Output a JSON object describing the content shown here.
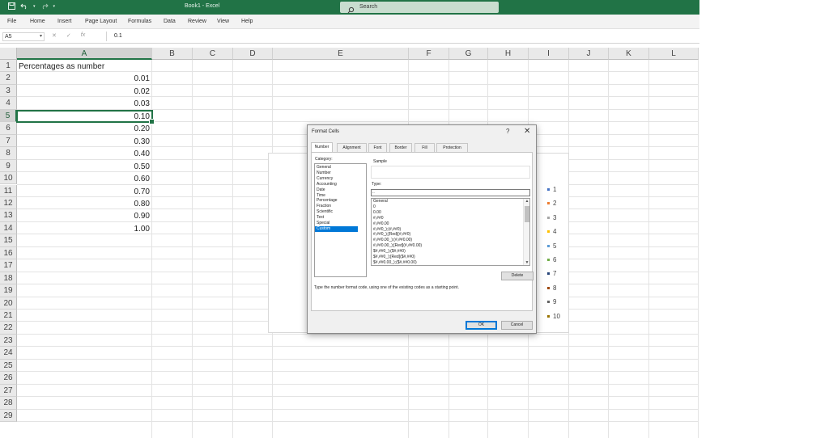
{
  "window": {
    "title": "Book1 - Excel",
    "search_placeholder": "Search"
  },
  "icons": {
    "save": "save-icon",
    "undo": "undo-icon",
    "redo": "redo-icon",
    "search": "search-icon"
  },
  "menu": [
    "File",
    "Home",
    "Insert",
    "Page Layout",
    "Formulas",
    "Data",
    "Review",
    "View",
    "Help"
  ],
  "formula_bar": {
    "name_box": "A5",
    "formula": "0.1",
    "fx": "fx",
    "cancel": "✕",
    "enter": "✓"
  },
  "sheet": {
    "columns": [
      "A",
      "B",
      "C",
      "D",
      "E",
      "F",
      "G",
      "H",
      "I",
      "J",
      "K",
      "L"
    ],
    "rows": [
      "1",
      "2",
      "3",
      "4",
      "5",
      "6",
      "7",
      "8",
      "9",
      "10",
      "11",
      "12",
      "13",
      "14",
      "15",
      "16",
      "17",
      "18",
      "19",
      "20",
      "21",
      "22",
      "23",
      "24",
      "25",
      "26",
      "27",
      "28",
      "29"
    ],
    "selected_column": "A",
    "selected_row": "5",
    "header_cell": "Percentages as number",
    "values": [
      "0.01",
      "0.02",
      "0.03",
      "0.10",
      "0.20",
      "0.30",
      "0.40",
      "0.50",
      "0.60",
      "0.70",
      "0.80",
      "0.90",
      "1.00"
    ]
  },
  "chart_legend": {
    "labels": [
      "1",
      "2",
      "3",
      "4",
      "5",
      "6",
      "7",
      "8",
      "9",
      "10"
    ],
    "colors": [
      "#4472c4",
      "#ed7d31",
      "#a5a5a5",
      "#ffc000",
      "#5b9bd5",
      "#70ad47",
      "#264478",
      "#9e480e",
      "#636363",
      "#997300"
    ]
  },
  "dialog": {
    "title": "Format Cells",
    "help": "?",
    "close": "✕",
    "tabs": [
      "Number",
      "Alignment",
      "Font",
      "Border",
      "Fill",
      "Protection"
    ],
    "active_tab": "Number",
    "category_label": "Category:",
    "categories": [
      "General",
      "Number",
      "Currency",
      "Accounting",
      "Date",
      "Time",
      "Percentage",
      "Fraction",
      "Scientific",
      "Text",
      "Special",
      "Custom"
    ],
    "selected_category": "Custom",
    "sample_label": "Sample",
    "type_label": "Type:",
    "type_value": "..",
    "formats": [
      "General",
      "0",
      "0.00",
      "#,##0",
      "#,##0.00",
      "#,##0_);(#,##0)",
      "#,##0_);[Red](#,##0)",
      "#,##0.00_);(#,##0.00)",
      "#,##0.00_);[Red](#,##0.00)",
      "$#,##0_);($#,##0)",
      "$#,##0_);[Red]($#,##0)",
      "$#,##0.00_);($#,##0.00)"
    ],
    "delete_button": "Delete",
    "hint": "Type the number format code, using one of the existing codes as a starting point.",
    "ok_button": "OK",
    "cancel_button": "Cancel"
  }
}
